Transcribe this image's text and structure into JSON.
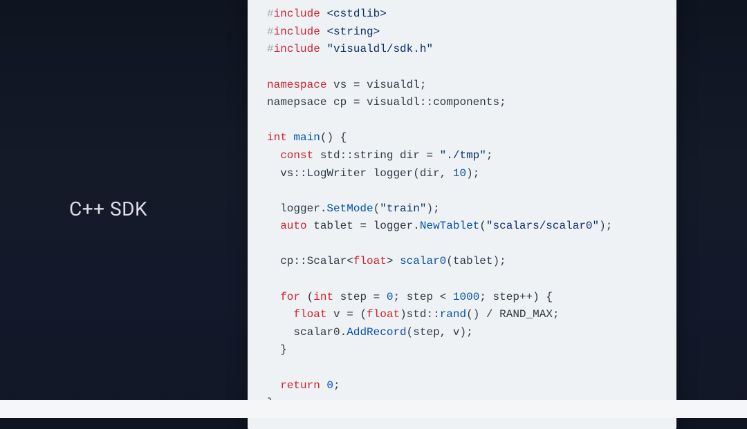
{
  "slide": {
    "title": "C++ SDK"
  },
  "code": {
    "preproc_hash": "#",
    "kw_include": "include",
    "hdr_cstdlib": "<cstdlib>",
    "hdr_string": "<string>",
    "hdr_visualdl": "\"visualdl/sdk.h\"",
    "kw_namespace": "namespace",
    "kw_namepsace": "namepsace",
    "alias_vs": "vs",
    "assign_eq": " = ",
    "ns_visualdl": "visualdl",
    "semicolon": ";",
    "alias_cp": "cp",
    "scope_op": "::",
    "ns_components": "components",
    "type_int": "int",
    "fn_main": "main",
    "lparen": "(",
    "rparen": ")",
    "lbrace": " {",
    "rbrace": "}",
    "kw_const": "const",
    "ns_std": "std",
    "type_string": "string",
    "var_dir": " dir",
    "str_tmp": "\"./tmp\"",
    "type_LogWriter": "LogWriter",
    "var_logger": " logger",
    "arg_dir": "dir",
    "comma": ", ",
    "num_10": "10",
    "dot": ".",
    "fn_SetMode": "SetMode",
    "str_train": "\"train\"",
    "kw_auto": "auto",
    "var_tablet": " tablet",
    "fn_NewTablet": "NewTablet",
    "str_scalar_path": "\"scalars/scalar0\"",
    "type_Scalar": "Scalar",
    "tmpl_open": "<",
    "type_float": "float",
    "tmpl_close": ">",
    "fn_scalar0": "scalar0",
    "arg_tablet": "tablet",
    "kw_for": "for",
    "var_step": " step",
    "num_0": "0",
    "cond_sep": "; ",
    "lt": " < ",
    "num_1000": "1000",
    "inc": "step++",
    "cast_open": "(",
    "cast_close": ")",
    "var_v": " v",
    "fn_rand": "rand",
    "div": " / ",
    "ident_randmax": "RAND_MAX",
    "ident_scalar0": "scalar0",
    "fn_AddRecord": "AddRecord",
    "arg_step": "step",
    "arg_v": "v",
    "kw_return": "return",
    "ret_val": " 0"
  }
}
